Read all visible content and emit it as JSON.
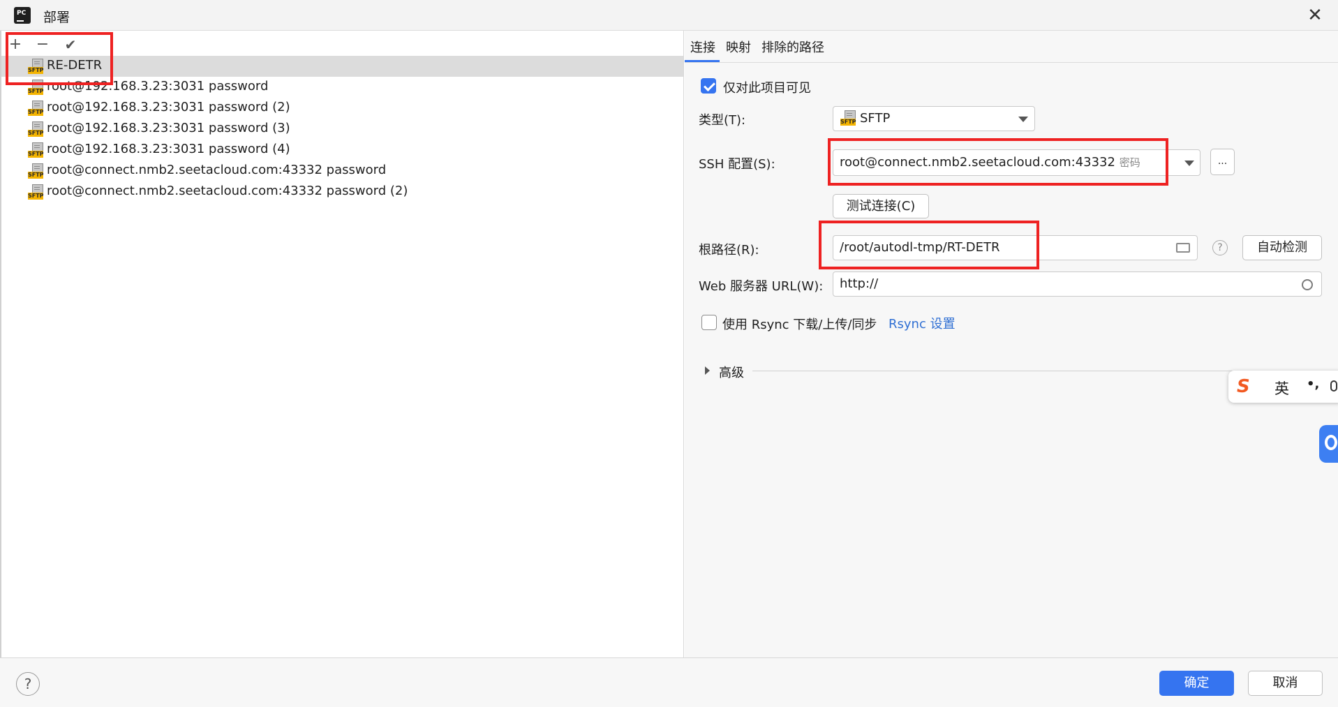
{
  "window": {
    "title": "部署",
    "close_glyph": "✕",
    "app_icon_text": "PC"
  },
  "toolbar": {
    "add_glyph": "+",
    "remove_glyph": "−",
    "check_glyph": "✔"
  },
  "servers": [
    {
      "label": "RE-DETR",
      "selected": true
    },
    {
      "label": "root@192.168.3.23:3031 password",
      "selected": false
    },
    {
      "label": "root@192.168.3.23:3031 password (2)",
      "selected": false
    },
    {
      "label": "root@192.168.3.23:3031 password (3)",
      "selected": false
    },
    {
      "label": "root@192.168.3.23:3031 password (4)",
      "selected": false
    },
    {
      "label": "root@connect.nmb2.seetacloud.com:43332 password",
      "selected": false
    },
    {
      "label": "root@connect.nmb2.seetacloud.com:43332 password (2)",
      "selected": false
    }
  ],
  "sftp_tag": "SFTP",
  "tabs": [
    {
      "label": "连接",
      "active": true
    },
    {
      "label": "映射",
      "active": false
    },
    {
      "label": "排除的路径",
      "active": false
    }
  ],
  "form": {
    "visible_only_label": "仅对此项目可见",
    "visible_only_checked": true,
    "type_label": "类型(T):",
    "type_value": "SFTP",
    "ssh_label": "SSH 配置(S):",
    "ssh_value": "root@connect.nmb2.seetacloud.com:43332",
    "ssh_suffix": "密码",
    "ssh_more": "...",
    "test_button": "测试连接(C)",
    "root_label": "根路径(R):",
    "root_value": "/root/autodl-tmp/RT-DETR",
    "autodetect_button": "自动检测",
    "help_glyph": "?",
    "web_label": "Web 服务器 URL(W):",
    "web_value": "http://",
    "rsync_label": "使用 Rsync 下载/上传/同步",
    "rsync_checked": false,
    "rsync_link": "Rsync 设置",
    "advanced_label": "高级"
  },
  "footer": {
    "help_glyph": "?",
    "ok_label": "确定",
    "cancel_label": "取消"
  },
  "ime": {
    "logo": "S",
    "lang": "英",
    "punct": "•,",
    "mic_icon": "mic-icon"
  },
  "colors": {
    "accent": "#3574f0",
    "highlight_box": "#ee2222",
    "sftp_tag": "#f4b400"
  }
}
